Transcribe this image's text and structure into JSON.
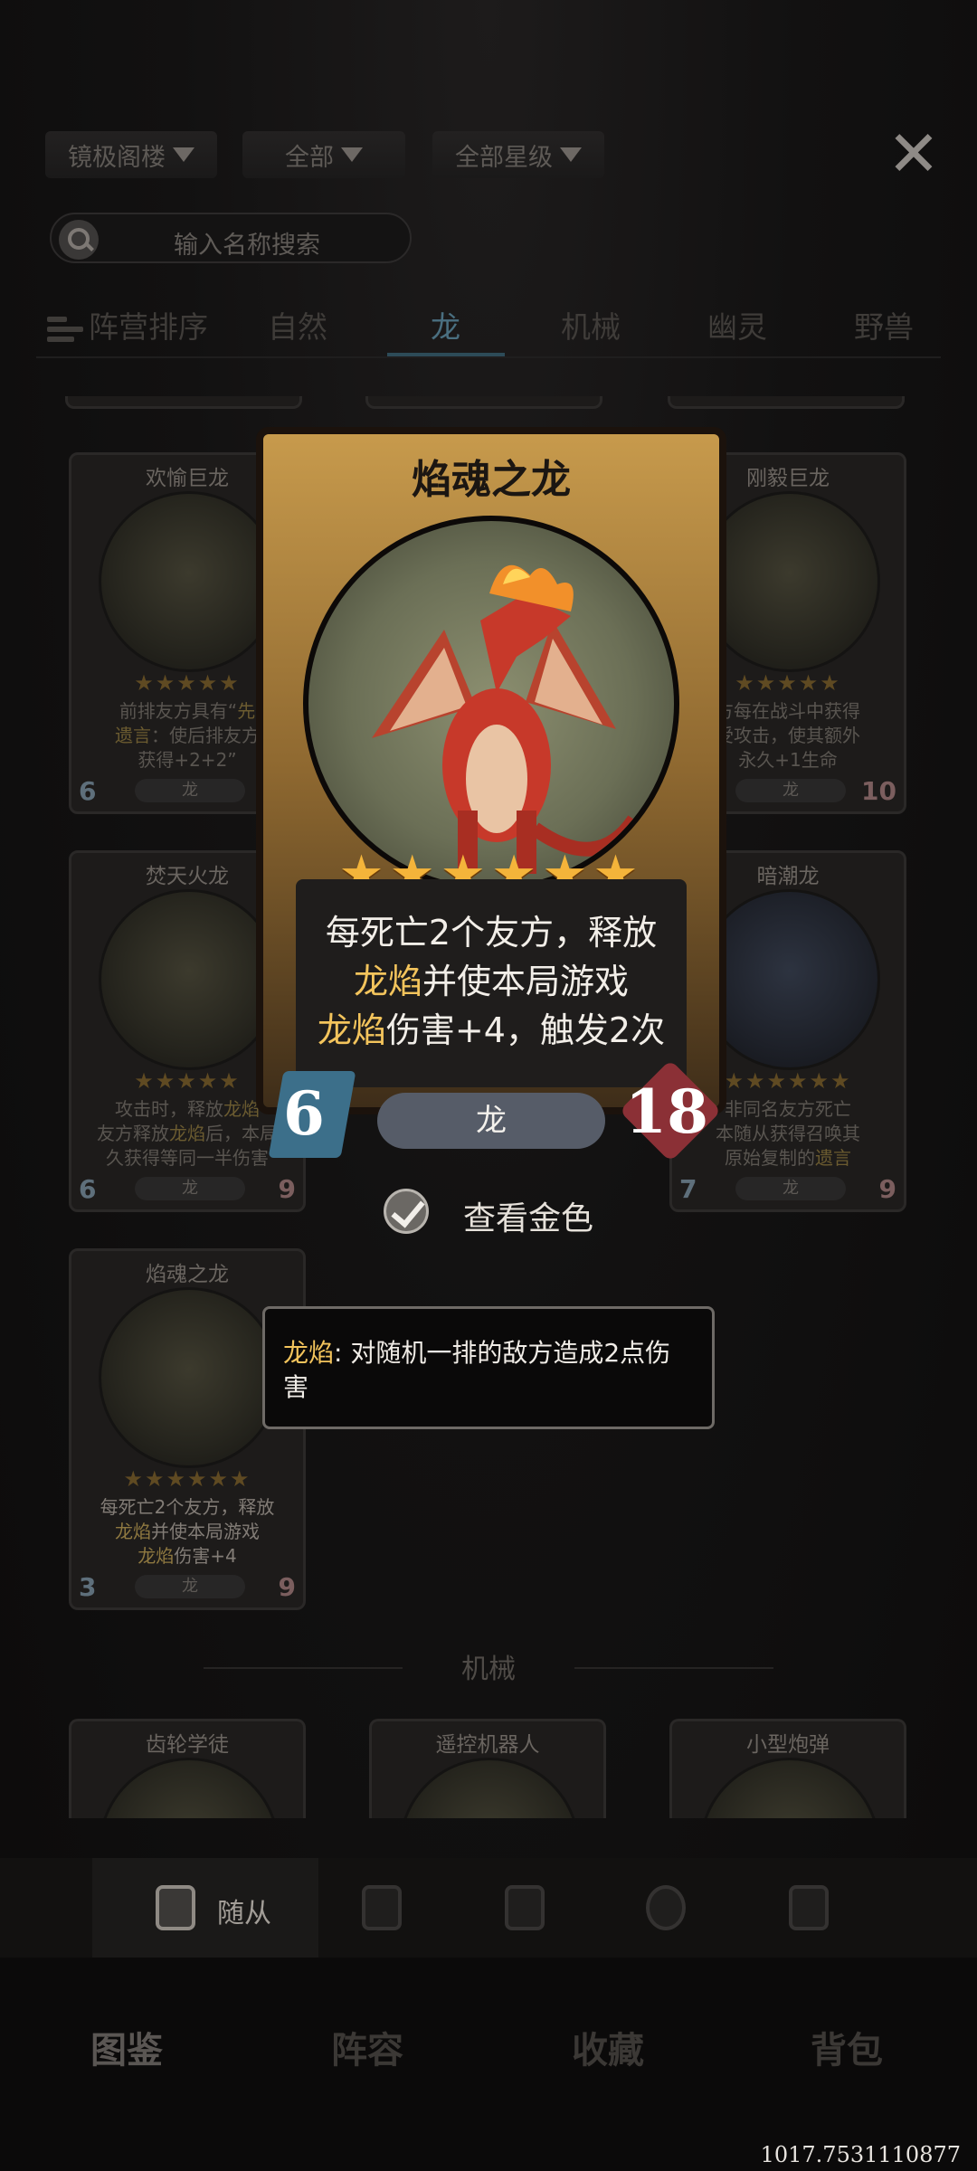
{
  "filters": [
    {
      "label": "镜极阁楼"
    },
    {
      "label": "全部"
    },
    {
      "label": "全部星级"
    }
  ],
  "search": {
    "placeholder": "输入名称搜索"
  },
  "tabs": {
    "sort_label": "阵营排序",
    "items": [
      "自然",
      "龙",
      "机械",
      "幽灵",
      "野兽"
    ],
    "active": "龙"
  },
  "cards": {
    "joyful": {
      "name": "欢愉巨龙",
      "stars": "★★★★★",
      "line1": "前排友方具有“",
      "line1_kw": "先",
      "line2_kw": "遗言",
      "line2": "：使后排友方",
      "line3": "获得+2+2”",
      "atk": "6",
      "race": "龙"
    },
    "steel": {
      "name": "刚毅巨龙",
      "stars": "★★★★★",
      "line1": "方每在战斗中获得",
      "line2": "受攻击，使其额外",
      "line3": "永久+1生命",
      "race": "龙",
      "hp": "10"
    },
    "blaze": {
      "name": "焚天火龙",
      "stars": "★★★★★",
      "line1": "攻击时，释放",
      "line1_kw": "龙焰",
      "line2": "友方释放",
      "line2_kw": "龙焰",
      "line2b": "后，本局",
      "line3": "久获得等同一半伤害",
      "atk": "6",
      "race": "龙",
      "hp": "9"
    },
    "tide": {
      "name": "暗潮龙",
      "stars": "★★★★★★",
      "line1": "非同名友方死亡",
      "line2": "本随从获得召唤其",
      "line3a": "原始复制的",
      "line3_kw": "遗言",
      "atk": "7",
      "race": "龙",
      "hp": "9"
    },
    "soul_small": {
      "name": "焰魂之龙",
      "stars": "★★★★★★",
      "line1": "每死亡2个友方，释放",
      "line2_kw": "龙焰",
      "line2": "并使本局游戏",
      "line3_kw": "龙焰",
      "line3": "伤害+4",
      "atk": "3",
      "race": "龙",
      "hp": "9"
    },
    "gear": {
      "name": "齿轮学徒"
    },
    "remote": {
      "name": "遥控机器人"
    },
    "bomb": {
      "name": "小型炮弹"
    }
  },
  "featured": {
    "name": "焰魂之龙",
    "stars": "★★★★★★",
    "line1": "每死亡2个友方，释放",
    "line2_kw": "龙焰",
    "line2": "并使本局游戏",
    "line3_kw": "龙焰",
    "line3": "伤害+4，触发2次",
    "atk": "6",
    "race": "龙",
    "hp": "18"
  },
  "gold_toggle": {
    "label": "查看金色",
    "checked": true
  },
  "tooltip": {
    "keyword": "龙焰",
    "text": ": 对随机一排的敌方造成2点伤害"
  },
  "section_label": "机械",
  "subnav": {
    "active_label": "随从",
    "icons": [
      "minion-icon",
      "spell-icon",
      "card-swap-icon",
      "hero-icon",
      "home-icon"
    ]
  },
  "mainnav": [
    "图鉴",
    "阵容",
    "收藏",
    "背包"
  ],
  "coords": "1017.7531110877"
}
